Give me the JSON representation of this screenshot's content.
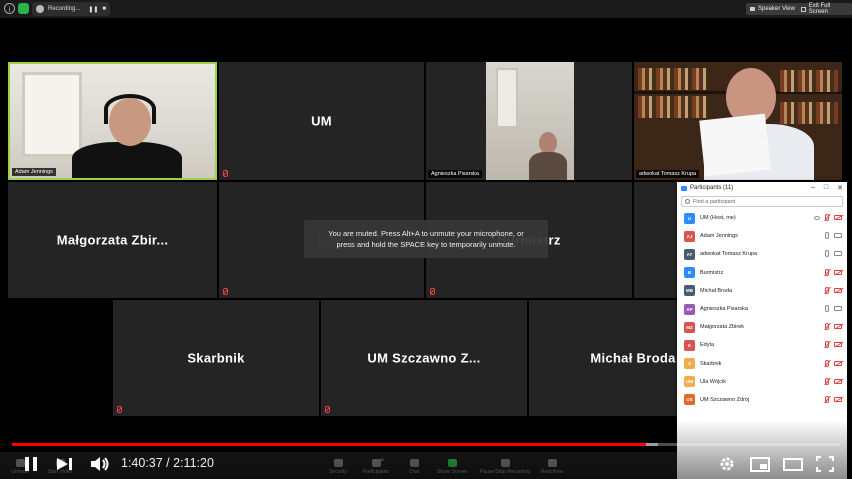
{
  "recording_bar": {
    "label": "Recording..."
  },
  "top_buttons": {
    "speaker_view": "Speaker View",
    "exit_full_screen": "Exit Full Screen"
  },
  "gallery": [
    {
      "name": "Adam Jennings",
      "label": "Adam Jennings",
      "video": true,
      "active": true
    },
    {
      "name": "UM",
      "label": "",
      "video": false,
      "muted": true
    },
    {
      "name": "Agnieszka Pisarska",
      "label": "Agnieszka Pisarska",
      "video": true
    },
    {
      "name": "adwokat Tomasz Krupa",
      "label": "adwokat Tomasz Krupa",
      "video": true
    },
    {
      "name": "Małgorzata  Zbir...",
      "label": "",
      "video": false,
      "muted": true
    },
    {
      "name": "Edy",
      "label": "",
      "video": false,
      "muted": true
    },
    {
      "name": "Burmistrz",
      "label": "",
      "video": false,
      "muted": true
    },
    {
      "name": "Skarbnik",
      "label": "",
      "video": false,
      "muted": true
    },
    {
      "name": "UM  Szczawno  Z...",
      "label": "",
      "video": false,
      "muted": true
    },
    {
      "name": "Michał  Broda",
      "label": "",
      "video": false,
      "muted": true
    }
  ],
  "toast": {
    "line1": "You are muted. Press Alt+A to unmute your microphone, or",
    "line2": "press and hold the SPACE key to temporarily unmute."
  },
  "participants_panel": {
    "title": "Participants (11)",
    "search_placeholder": "Find a participant",
    "participants": [
      {
        "initials": "U",
        "name": "UM (Host, me)",
        "color": "#2d8cff",
        "mic": "muted",
        "cam": "muted",
        "eye": true
      },
      {
        "initials": "AJ",
        "name": "Adam Jennings",
        "color": "#d9534f",
        "mic": "on",
        "cam": "on"
      },
      {
        "initials": "AT",
        "name": "adwokat Tomasz Krupa",
        "color": "#4a5a70",
        "mic": "on",
        "cam": "on"
      },
      {
        "initials": "B",
        "name": "Burmistrz",
        "color": "#2d8cff",
        "mic": "muted",
        "cam": "muted"
      },
      {
        "initials": "MB",
        "name": "Michał Broda",
        "color": "#4a5a70",
        "mic": "muted",
        "cam": "muted"
      },
      {
        "initials": "AP",
        "name": "Agnieszka Pisarska",
        "color": "#9b59b6",
        "mic": "on",
        "cam": "on"
      },
      {
        "initials": "MZ",
        "name": "Małgorzata Zbirek",
        "color": "#d9534f",
        "mic": "muted",
        "cam": "muted"
      },
      {
        "initials": "E",
        "name": "Edyta",
        "color": "#d9534f",
        "mic": "muted",
        "cam": "muted"
      },
      {
        "initials": "S",
        "name": "Skarbnik",
        "color": "#f0ad4e",
        "mic": "muted",
        "cam": "muted"
      },
      {
        "initials": "UW",
        "name": "Ula Wójcik",
        "color": "#f0ad4e",
        "mic": "muted",
        "cam": "muted"
      },
      {
        "initials": "US",
        "name": "UM Szczawno Zdrój",
        "color": "#e06a2a",
        "mic": "muted",
        "cam": "muted"
      }
    ]
  },
  "zoom_toolbar": {
    "unmute": "Unmute",
    "start_video": "Start Video",
    "security": "Security",
    "participants": "Participants",
    "participants_count": "11",
    "chat": "Chat",
    "share_screen": "Share Screen",
    "pause_recording": "Pause/Stop Recording",
    "reactions": "Reactions"
  },
  "player": {
    "current_time": "1:40:37",
    "duration": "2:11:20",
    "time_display": "1:40:37 / 2:11:20",
    "played_fraction": 0.766,
    "buffered_fraction": 0.78,
    "accent": "#ff0000"
  }
}
